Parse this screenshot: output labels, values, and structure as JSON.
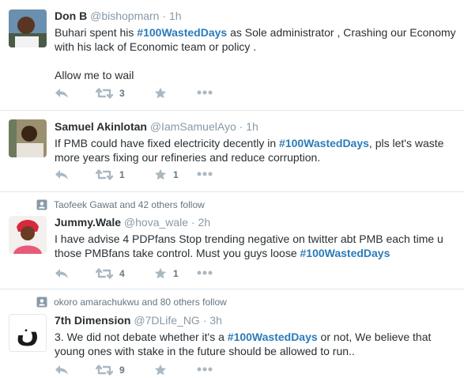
{
  "tweets": [
    {
      "context": null,
      "fullname": "Don B",
      "username": "@bishopmarn",
      "separator": "·",
      "time": "1h",
      "text_before": "Buhari spent his ",
      "hashtag": "#100WastedDays",
      "text_after": " as Sole administrator , Crashing our Economy with his lack of Economic team or policy .",
      "text_line2": "Allow me to wail",
      "retweets": "3",
      "likes": ""
    },
    {
      "context": null,
      "fullname": "Samuel Akinlotan",
      "username": "@IamSamuelAyo",
      "separator": "·",
      "time": "1h",
      "text_before": "If PMB could have fixed electricity decently in ",
      "hashtag": "#100WastedDays",
      "text_after": ", pls let's waste more years fixing our refineries and reduce corruption.",
      "retweets": "1",
      "likes": "1"
    },
    {
      "context": "Taofeek Gawat and 42 others follow",
      "fullname": "Jummy.Wale",
      "username": "@hova_wale",
      "separator": "·",
      "time": "2h",
      "text_before": "I have advise 4 PDPfans Stop trending negative on twitter abt PMB each time u those PMBfans take control. Must you guys loose ",
      "hashtag": "#100WastedDays",
      "text_after": "",
      "retweets": "4",
      "likes": "1"
    },
    {
      "context": "okoro amarachukwu and 80 others follow",
      "fullname": "7th Dimension",
      "username": "@7DLife_NG",
      "separator": "·",
      "time": "3h",
      "text_before": "3. We did not debate whether it's a ",
      "hashtag": "#100WastedDays",
      "text_after": " or not, We believe that young ones with stake in the future should be allowed to run..",
      "retweets": "9",
      "likes": ""
    }
  ],
  "colors": {
    "accent": "#2b7bb9",
    "muted": "#8899a6",
    "text": "#292f33",
    "divider": "#e1e8ed"
  },
  "icons": [
    "reply-icon",
    "retweet-icon",
    "like-icon",
    "more-icon",
    "person-follow-icon"
  ],
  "avatar4_glyph": "ن"
}
